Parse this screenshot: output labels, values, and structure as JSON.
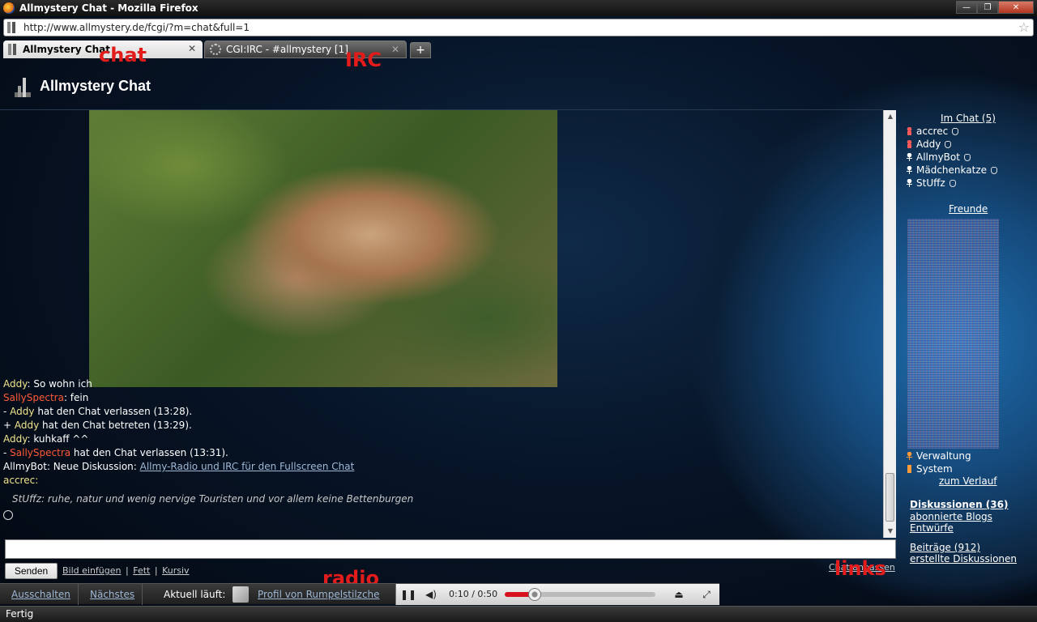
{
  "window": {
    "title": "Allmystery Chat - Mozilla Firefox"
  },
  "urlbar": {
    "url": "http://www.allmystery.de/fcgi/?m=chat&full=1"
  },
  "tabs": [
    {
      "label": "Allmystery Chat"
    },
    {
      "label": "CGI:IRC - #allmystery [1]"
    }
  ],
  "annotations": {
    "chat": "chat",
    "irc": "IRC",
    "radio": "radio",
    "links": "links"
  },
  "page": {
    "title": "Allmystery Chat"
  },
  "chat": {
    "lines": [
      {
        "pre": "",
        "nick": "Addy",
        "nick_color": "addy",
        "post": ": So wohn ich"
      },
      {
        "pre": "",
        "nick": "SallySpectra",
        "nick_color": "sally",
        "post": ": fein"
      },
      {
        "pre": "- ",
        "nick": "Addy",
        "nick_color": "addy",
        "post": " hat den Chat verlassen (13:28)."
      },
      {
        "pre": "+ ",
        "nick": "Addy",
        "nick_color": "addy",
        "post": " hat den Chat betreten (13:29)."
      },
      {
        "pre": "",
        "nick": "Addy",
        "nick_color": "addy",
        "post": ": kuhkaff ^^"
      },
      {
        "pre": "- ",
        "nick": "SallySpectra",
        "nick_color": "sally",
        "post": " hat den Chat verlassen (13:31)."
      }
    ],
    "bot_line": {
      "prefix": "AllmyBot: Neue Diskussion: ",
      "link": "Allmy-Radio und IRC für den Fullscreen Chat"
    },
    "self_nick": "accrec:",
    "typing": "StUffz: ruhe, natur und wenig nervige Touristen und vor allem keine Bettenburgen",
    "input_value": ""
  },
  "controls": {
    "send": "Senden",
    "insert_image": "Bild einfügen",
    "bold": "Fett",
    "italic": "Kursiv",
    "separator": "|"
  },
  "sidebar": {
    "in_chat_header": "Im Chat (5)",
    "in_chat": [
      {
        "name": "accrec",
        "icon": "red"
      },
      {
        "name": "Addy",
        "icon": "red"
      },
      {
        "name": "AllmyBot",
        "icon": "white"
      },
      {
        "name": "Mädchenkatze",
        "icon": "white"
      },
      {
        "name": "StUffz",
        "icon": "white"
      }
    ],
    "friends_header": "Freunde",
    "admin": "Verwaltung",
    "system": "System",
    "history": "zum Verlauf",
    "discussions": "Diskussionen (36)",
    "subscribed_blogs": "abonnierte Blogs",
    "drafts": "Entwürfe",
    "posts": "Beiträge (912)",
    "created_discussions": "erstellte Diskussionen",
    "chat_extra": "Chat anpassen"
  },
  "radio": {
    "off": "Ausschalten",
    "next": "Nächstes",
    "now_playing_label": "Aktuell läuft:",
    "profile_link": "Profil von Rumpelstilzche",
    "time": "0:10 / 0:50",
    "progress": 0.2
  },
  "status": {
    "text": "Fertig"
  }
}
